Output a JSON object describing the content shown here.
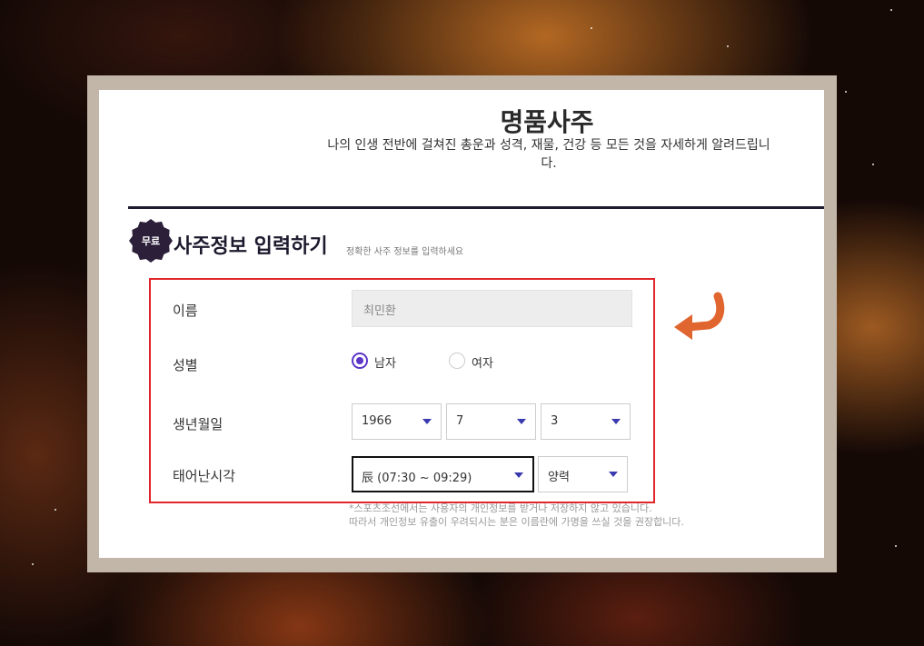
{
  "page": {
    "title": "명품사주",
    "description": "나의 인생 전반에 걸쳐진 총운과 성격, 재물, 건강 등 모든 것을 자세하게 알려드립니다."
  },
  "section": {
    "badge": "무료",
    "title": "사주정보 입력하기",
    "subtitle": "정확한 사주 정보를 입력하세요"
  },
  "form": {
    "name_label": "이름",
    "name_value": "최민환",
    "gender_label": "성별",
    "gender_options": [
      "남자",
      "여자"
    ],
    "gender_selected": "남자",
    "birth_label": "생년월일",
    "birth_year": "1966",
    "birth_month": "7",
    "birth_day": "3",
    "time_label": "태어난시각",
    "time_value": "辰 (07:30 ~ 09:29)",
    "calendar_value": "양력"
  },
  "notice": {
    "line1": "*스포츠조선에서는 사용자의 개인정보를 받거나 저장하지 않고 있습니다.",
    "line2": "따라서 개인정보 유출이 우려되시는 분은 이름란에 가명을 쓰실 것을 권장합니다."
  },
  "colors": {
    "accent": "#5b34c8",
    "highlight_box": "#e0262b",
    "arrow": "#e0652f",
    "badge": "#2c1f3a"
  }
}
